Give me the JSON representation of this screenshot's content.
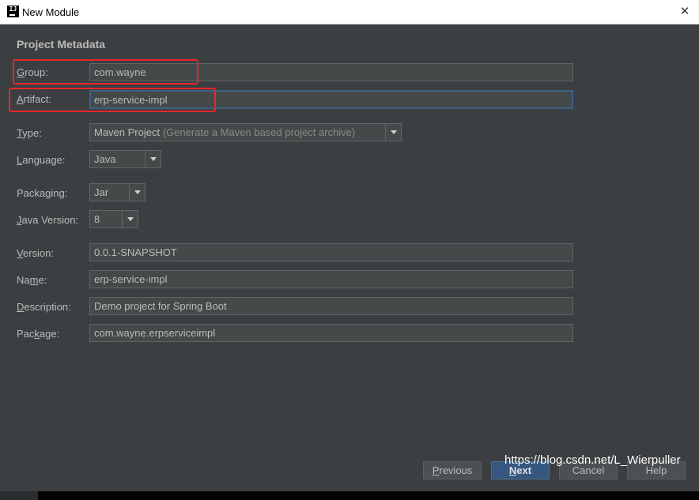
{
  "window": {
    "title": "New Module",
    "icon_text": "IJ",
    "close_glyph": "✕"
  },
  "section_title": "Project Metadata",
  "form": {
    "group": {
      "label_mnemonic": "G",
      "label_rest": "roup:",
      "value": "com.wayne"
    },
    "artifact": {
      "label_mnemonic": "A",
      "label_rest": "rtifact:",
      "value": "erp-service-impl"
    },
    "type": {
      "label_mnemonic": "T",
      "label_rest": "ype:",
      "value": "Maven Project",
      "hint": "(Generate a Maven based project archive)"
    },
    "language": {
      "label_mnemonic": "L",
      "label_rest": "anguage:",
      "value": "Java"
    },
    "packaging": {
      "label_pre": "Packa",
      "label_mnemonic": "g",
      "label_rest": "ing:",
      "value": "Jar"
    },
    "java_version": {
      "label_mnemonic": "J",
      "label_rest": "ava Version:",
      "value": "8"
    },
    "version": {
      "label_mnemonic": "V",
      "label_rest": "ersion:",
      "value": "0.0.1-SNAPSHOT"
    },
    "name": {
      "label_pre": "Na",
      "label_mnemonic": "m",
      "label_rest": "e:",
      "value": "erp-service-impl"
    },
    "description": {
      "label_mnemonic": "D",
      "label_rest": "escription:",
      "value": "Demo project for Spring Boot"
    },
    "package": {
      "label_pre": "Pac",
      "label_mnemonic": "k",
      "label_rest": "age:",
      "value": "com.wayne.erpserviceimpl"
    }
  },
  "buttons": {
    "previous": {
      "mnemonic": "P",
      "rest": "revious"
    },
    "next": {
      "mnemonic": "N",
      "rest": "ext"
    },
    "cancel": "Cancel",
    "help": "Help"
  },
  "watermark": "https://blog.csdn.net/L_Wierpuller",
  "colors": {
    "background": "#3c3f41",
    "field_background": "#45494a",
    "text": "#bbbbbb",
    "highlight_red": "#e8262b",
    "default_button": "#365880"
  }
}
